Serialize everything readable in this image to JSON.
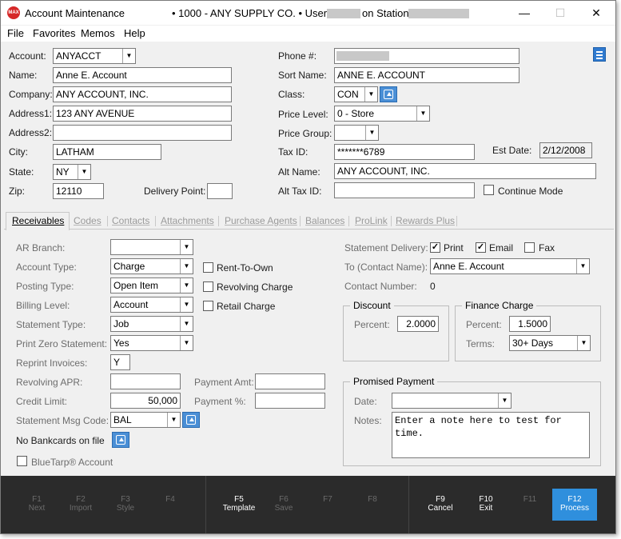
{
  "title_bar": {
    "title": "Account Maintenance",
    "company": "•  1000 - ANY SUPPLY CO.  •  User:",
    "station_label": "on Station:",
    "minimize": "—",
    "maximize": "☐",
    "close": "✕",
    "icon_text": "MAX"
  },
  "menu": {
    "file": "File",
    "favorites": "Favorites",
    "memos": "Memos",
    "help": "Help"
  },
  "header": {
    "account_label": "Account:",
    "account_value": "ANYACCT",
    "name_label": "Name:",
    "name_value": "Anne E. Account",
    "company_label": "Company:",
    "company_value": "ANY ACCOUNT, INC.",
    "address1_label": "Address1:",
    "address1_value": "123 ANY AVENUE",
    "address2_label": "Address2:",
    "address2_value": "",
    "city_label": "City:",
    "city_value": "LATHAM",
    "state_label": "State:",
    "state_value": "NY",
    "zip_label": "Zip:",
    "zip_value": "12110",
    "delivery_point_label": "Delivery Point:",
    "delivery_point_value": "",
    "phone_label": "Phone #:",
    "sort_name_label": "Sort Name:",
    "sort_name_value": "ANNE E. ACCOUNT",
    "class_label": "Class:",
    "class_value": "CON",
    "price_level_label": "Price Level:",
    "price_level_value": "0 - Store",
    "price_group_label": "Price Group:",
    "price_group_value": "",
    "tax_id_label": "Tax ID:",
    "tax_id_value": "*******6789",
    "est_date_label": "Est Date:",
    "est_date_value": "2/12/2008",
    "alt_name_label": "Alt  Name:",
    "alt_name_value": "ANY ACCOUNT, INC.",
    "alt_tax_id_label": "Alt Tax ID:",
    "alt_tax_id_value": "",
    "continue_mode_label": "Continue Mode"
  },
  "tabs": [
    "Receivables",
    "Codes",
    "Contacts",
    "Attachments",
    "Purchase Agents",
    "Balances",
    "ProLink",
    "Rewards Plus"
  ],
  "receivables": {
    "ar_branch_label": "AR Branch:",
    "ar_branch_value": "",
    "account_type_label": "Account Type:",
    "account_type_value": "Charge",
    "posting_type_label": "Posting Type:",
    "posting_type_value": "Open Item",
    "billing_level_label": "Billing Level:",
    "billing_level_value": "Account",
    "statement_type_label": "Statement Type:",
    "statement_type_value": "Job",
    "print_zero_label": "Print Zero Statement:",
    "print_zero_value": "Yes",
    "reprint_label": "Reprint Invoices:",
    "reprint_value": "Y",
    "revolving_apr_label": "Revolving APR:",
    "revolving_apr_value": "",
    "credit_limit_label": "Credit Limit:",
    "credit_limit_value": "50,000",
    "statement_msg_label": "Statement Msg Code:",
    "statement_msg_value": "BAL",
    "no_bankcards_label": "No Bankcards on file",
    "bluetarp_label": "BlueTarp® Account",
    "payment_amt_label": "Payment Amt:",
    "payment_amt_value": "",
    "payment_pct_label": "Payment %:",
    "payment_pct_value": "",
    "rent_to_own_label": "Rent-To-Own",
    "revolving_charge_label": "Revolving Charge",
    "retail_charge_label": "Retail Charge",
    "statement_delivery_label": "Statement Delivery:",
    "print_label": "Print",
    "email_label": "Email",
    "fax_label": "Fax",
    "to_contact_label": "To (Contact Name):",
    "to_contact_value": "Anne E. Account",
    "contact_number_label": "Contact Number:",
    "contact_number_value": "0",
    "discount_title": "Discount",
    "discount_percent_label": "Percent:",
    "discount_percent_value": "2.0000",
    "finance_title": "Finance Charge",
    "finance_percent_label": "Percent:",
    "finance_percent_value": "1.5000",
    "finance_terms_label": "Terms:",
    "finance_terms_value": "30+ Days",
    "promised_title": "Promised Payment",
    "promised_date_label": "Date:",
    "promised_date_value": "",
    "notes_label": "Notes:",
    "notes_value": "Enter a note here to test for time."
  },
  "footer": [
    {
      "key": "F1",
      "label": "Next",
      "enabled": false
    },
    {
      "key": "F2",
      "label": "Import",
      "enabled": false
    },
    {
      "key": "F3",
      "label": "Style",
      "enabled": false
    },
    {
      "key": "F4",
      "label": "",
      "enabled": false
    },
    {
      "key": "F5",
      "label": "Template",
      "enabled": true
    },
    {
      "key": "F6",
      "label": "Save",
      "enabled": false
    },
    {
      "key": "F7",
      "label": "",
      "enabled": false
    },
    {
      "key": "F8",
      "label": "",
      "enabled": false
    },
    {
      "key": "F9",
      "label": "Cancel",
      "enabled": true
    },
    {
      "key": "F10",
      "label": "Exit",
      "enabled": true
    },
    {
      "key": "F11",
      "label": "",
      "enabled": false
    },
    {
      "key": "F12",
      "label": "Process",
      "enabled": true
    }
  ],
  "colors": {
    "accent": "#2f8fdd",
    "footer_bg": "#2b2b2b",
    "window_bg": "#f0f0f0"
  }
}
